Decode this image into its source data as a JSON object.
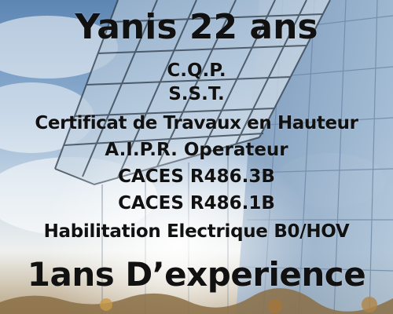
{
  "headline": "Yanis 22 ans",
  "qualifications": [
    "C.Q.P.",
    "S.S.T.",
    "Certificat de Travaux en Hauteur",
    "A.I.P.R. Operateur",
    "CACES R486.3B",
    "CACES R486.1B",
    "Habilitation Electrique B0/HOV"
  ],
  "experience": "1ans D’experience",
  "colors": {
    "text": "#111111",
    "sky_top": "#6f95bf",
    "sky_bottom": "#dfe7ef"
  }
}
